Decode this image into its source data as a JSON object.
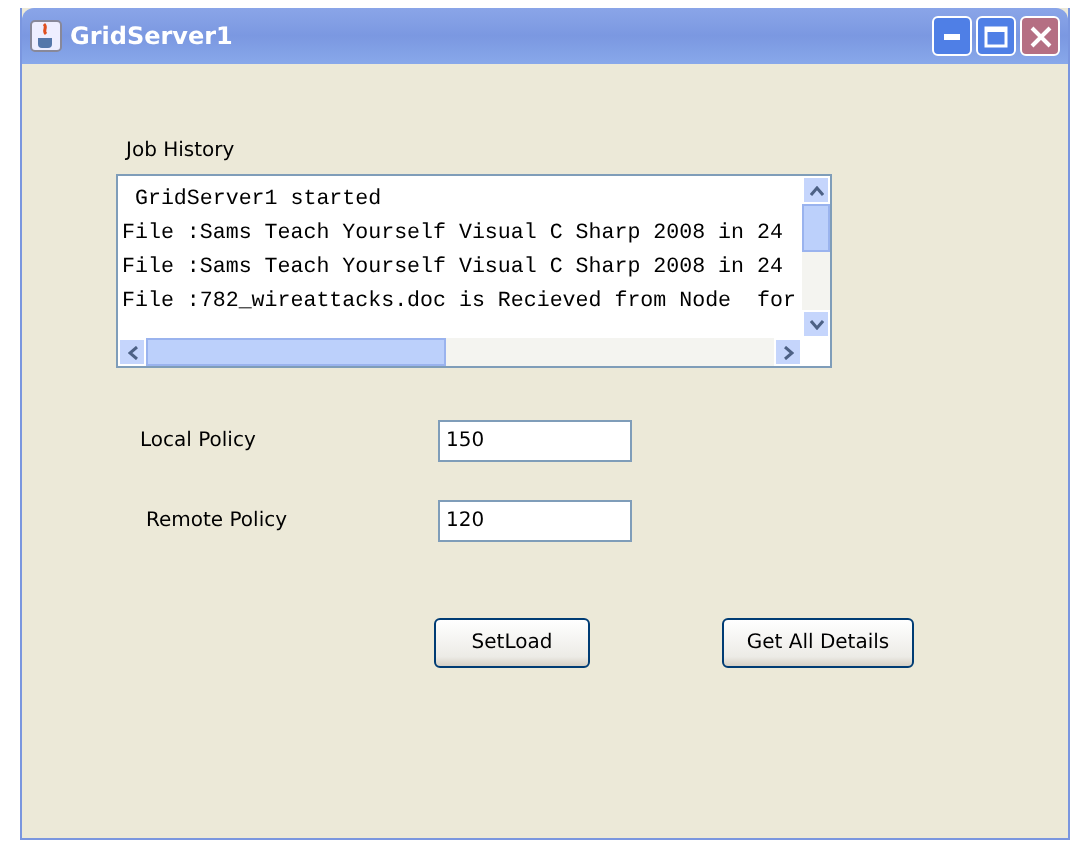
{
  "window": {
    "title": "GridServer1"
  },
  "job_history": {
    "label": "Job History",
    "lines": [
      " GridServer1 started",
      "File :Sams Teach Yourself Visual C Sharp 2008 in 24",
      "File :Sams Teach Yourself Visual C Sharp 2008 in 24",
      "File :782_wireattacks.doc is Recieved from Node  for"
    ]
  },
  "fields": [
    {
      "label": "Local Policy",
      "value": "150"
    },
    {
      "label": "Remote Policy",
      "value": "120"
    }
  ],
  "buttons": [
    "SetLoad",
    "Get All Details"
  ]
}
